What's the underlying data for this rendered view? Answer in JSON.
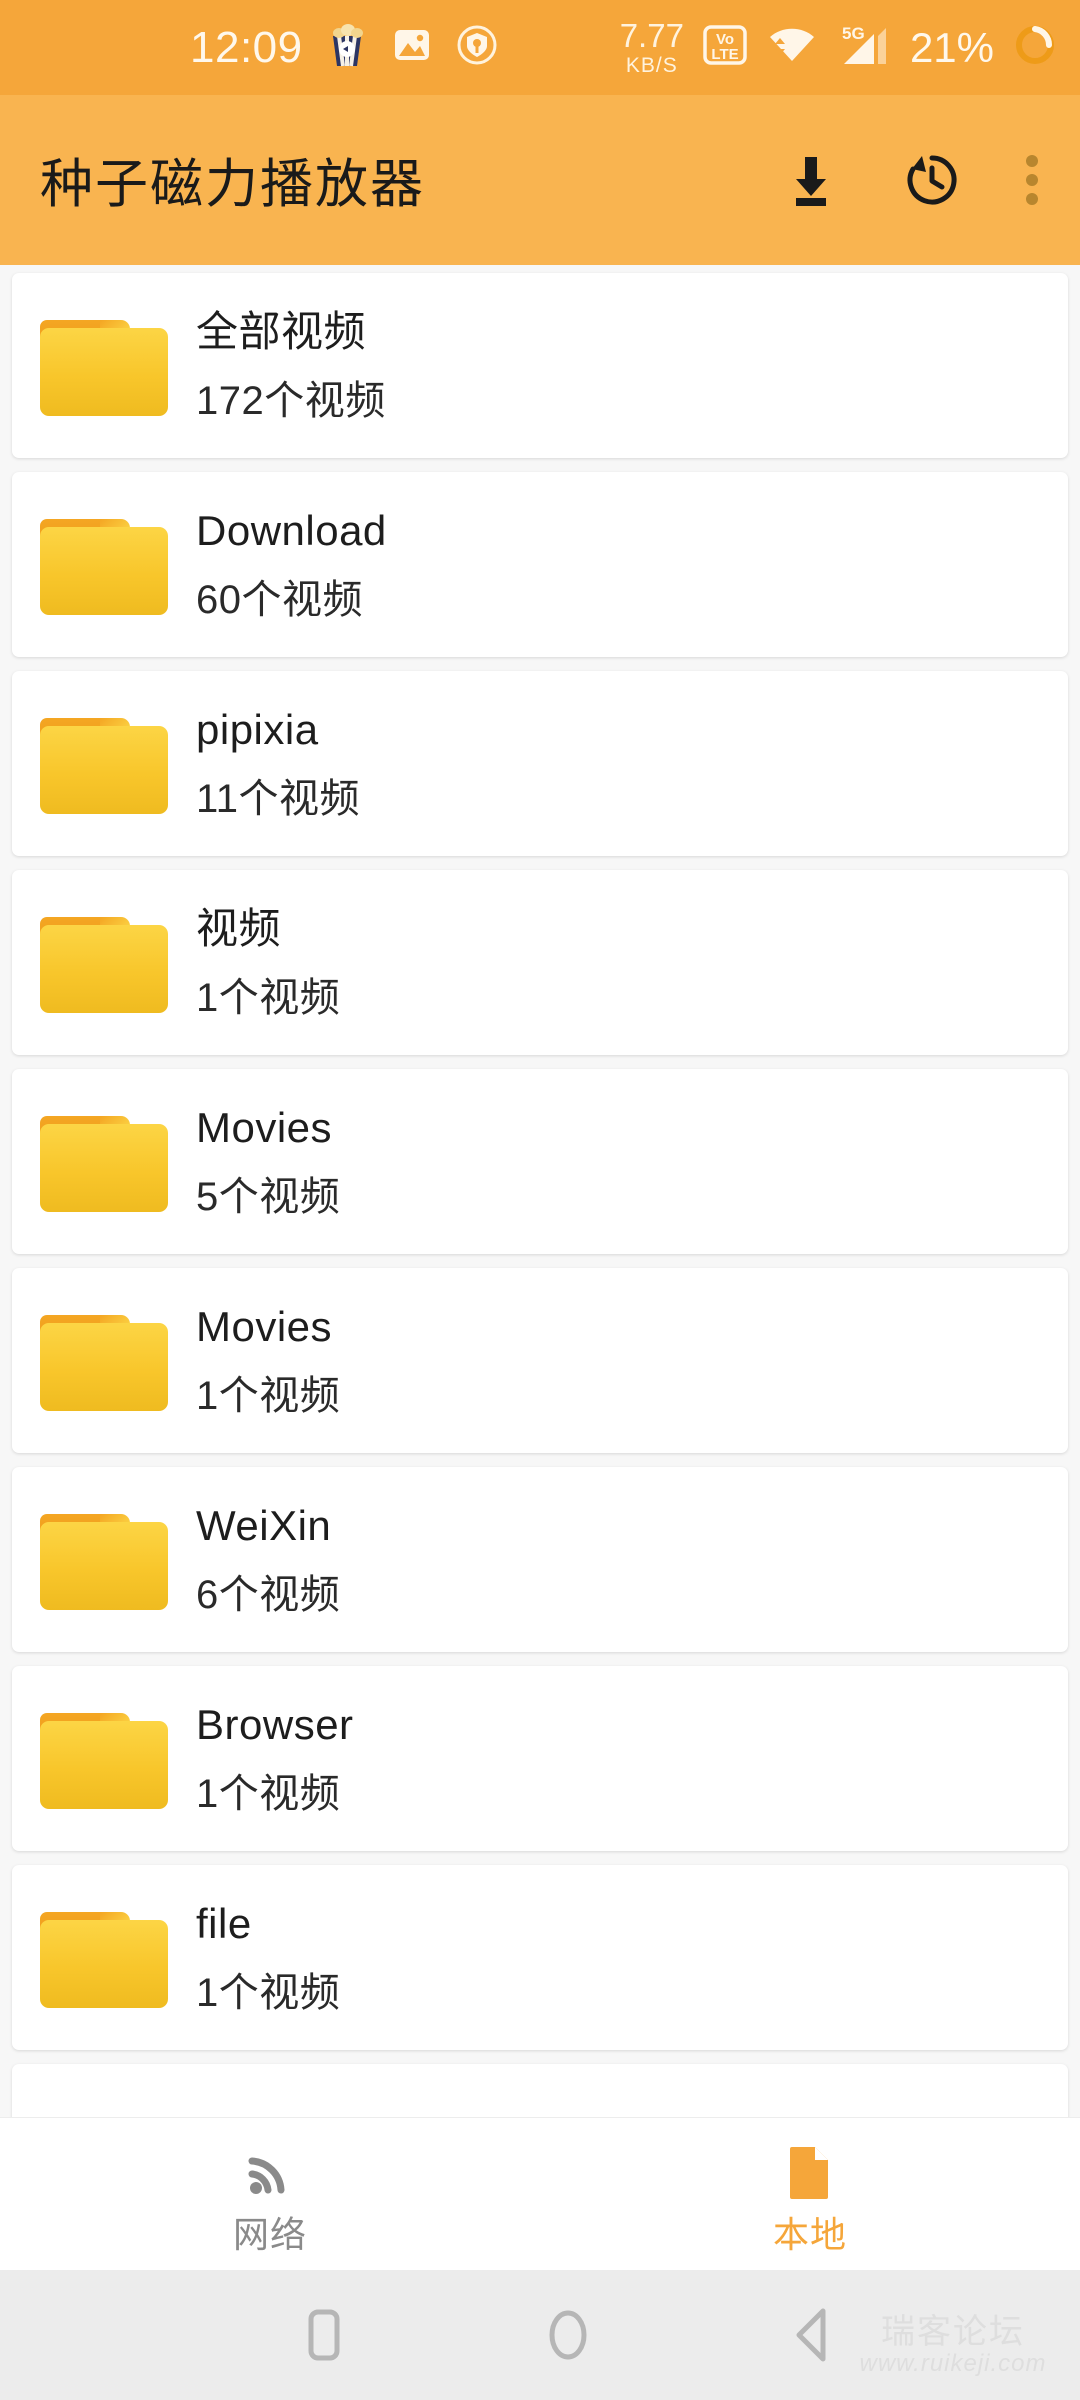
{
  "status_bar": {
    "time": "12:09",
    "net_speed_value": "7.77",
    "net_speed_unit": "KB/S",
    "volte_top": "Vo",
    "volte_sup": "LTE",
    "network_type": "5G",
    "battery_percent": "21%",
    "icons": [
      "popcorn-app-icon",
      "gallery-icon",
      "shield-vpn-icon",
      "volte-icon",
      "wifi-icon",
      "cellular-signal-icon",
      "battery-ring-icon"
    ],
    "background_color": "#F5A63A"
  },
  "app_bar": {
    "title": "种子磁力播放器",
    "background_color": "#F9B450",
    "actions": [
      {
        "name": "download-button",
        "icon": "download-icon"
      },
      {
        "name": "history-button",
        "icon": "history-icon"
      },
      {
        "name": "overflow-menu-button",
        "icon": "more-vert-icon"
      }
    ]
  },
  "folders": [
    {
      "name": "全部视频",
      "count": "172个视频"
    },
    {
      "name": "Download",
      "count": "60个视频"
    },
    {
      "name": "pipixia",
      "count": "11个视频"
    },
    {
      "name": "视频",
      "count": "1个视频"
    },
    {
      "name": "Movies",
      "count": "5个视频"
    },
    {
      "name": "Movies",
      "count": "1个视频"
    },
    {
      "name": "WeiXin",
      "count": "6个视频"
    },
    {
      "name": "Browser",
      "count": "1个视频"
    },
    {
      "name": "file",
      "count": "1个视频"
    },
    {
      "name": "",
      "count": ""
    }
  ],
  "bottom_tabs": [
    {
      "label": "网络",
      "icon": "rss-signal-icon",
      "active": false,
      "color": "#8A8A8A"
    },
    {
      "label": "本地",
      "icon": "document-file-icon",
      "active": true,
      "color": "#F5A63A"
    }
  ],
  "android_nav": {
    "recents": "square-recents-icon",
    "home": "circle-home-icon",
    "back": "triangle-back-icon"
  },
  "watermark": {
    "text_cn": "瑞客论坛",
    "text_url": "www.ruikeji.com"
  }
}
